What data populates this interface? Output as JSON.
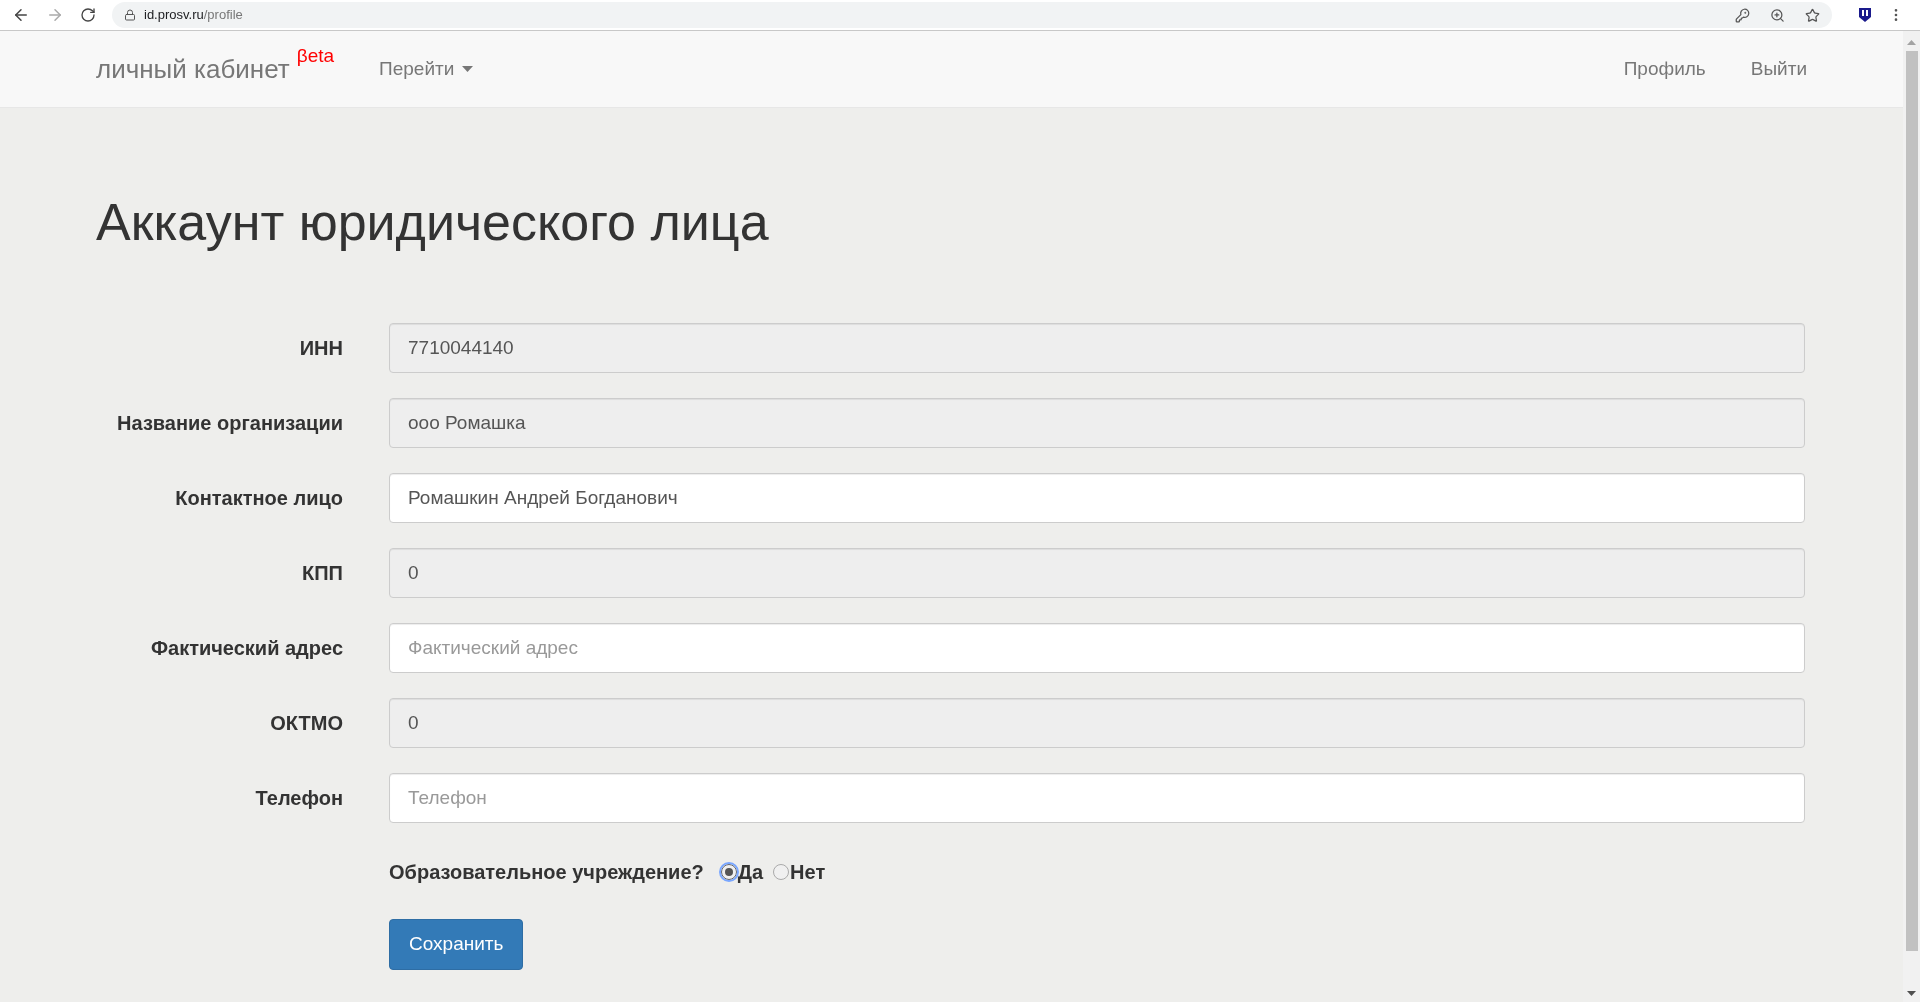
{
  "browser": {
    "url_host": "id.prosv.ru",
    "url_path": "/profile"
  },
  "navbar": {
    "brand": "личный кабинет",
    "brand_badge": "βeta",
    "menu": "Перейти",
    "links": [
      "Профиль",
      "Выйти"
    ]
  },
  "page": {
    "title": "Аккаунт юридического лица"
  },
  "fields": [
    {
      "label": "ИНН",
      "value": "7710044140",
      "disabled": true
    },
    {
      "label": "Название организации",
      "value": "ооо Ромашка",
      "disabled": true
    },
    {
      "label": "Контактное лицо",
      "value": "Ромашкин Андрей Богданович",
      "disabled": false
    },
    {
      "label": "КПП",
      "value": "0",
      "disabled": true
    },
    {
      "label": "Фактический адрес",
      "placeholder": "Фактический адрес",
      "disabled": false
    },
    {
      "label": "ОКТМО",
      "value": "0",
      "disabled": true
    },
    {
      "label": "Телефон",
      "placeholder": "Телефон",
      "disabled": false
    }
  ],
  "question": {
    "label": "Образовательное учреждение?",
    "options": [
      {
        "label": "Да",
        "selected": true
      },
      {
        "label": "Нет",
        "selected": false
      }
    ]
  },
  "save_button": "Сохранить"
}
